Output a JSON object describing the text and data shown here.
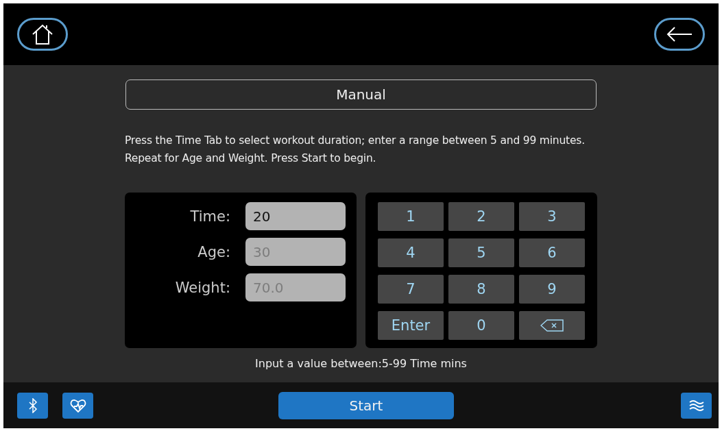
{
  "title": "Manual",
  "instructions": "Press the Time Tab to select workout duration; enter a range between 5 and 99 minutes. Repeat for Age and Weight. Press Start to begin.",
  "fields": [
    {
      "label": "Time:",
      "value": "20",
      "selected": true
    },
    {
      "label": "Age:",
      "value": "30",
      "selected": false
    },
    {
      "label": "Weight:",
      "value": "70.0",
      "selected": false
    }
  ],
  "keypad": [
    {
      "kind": "key",
      "label": "1"
    },
    {
      "kind": "key",
      "label": "2"
    },
    {
      "kind": "key",
      "label": "3"
    },
    {
      "kind": "key",
      "label": "4"
    },
    {
      "kind": "key",
      "label": "5"
    },
    {
      "kind": "key",
      "label": "6"
    },
    {
      "kind": "key",
      "label": "7"
    },
    {
      "kind": "key",
      "label": "8"
    },
    {
      "kind": "key",
      "label": "9"
    },
    {
      "kind": "key",
      "label": "Enter"
    },
    {
      "kind": "key",
      "label": "0"
    },
    {
      "kind": "backspace"
    }
  ],
  "hint": "Input a value between:5-99 Time mins",
  "start_button": "Start"
}
